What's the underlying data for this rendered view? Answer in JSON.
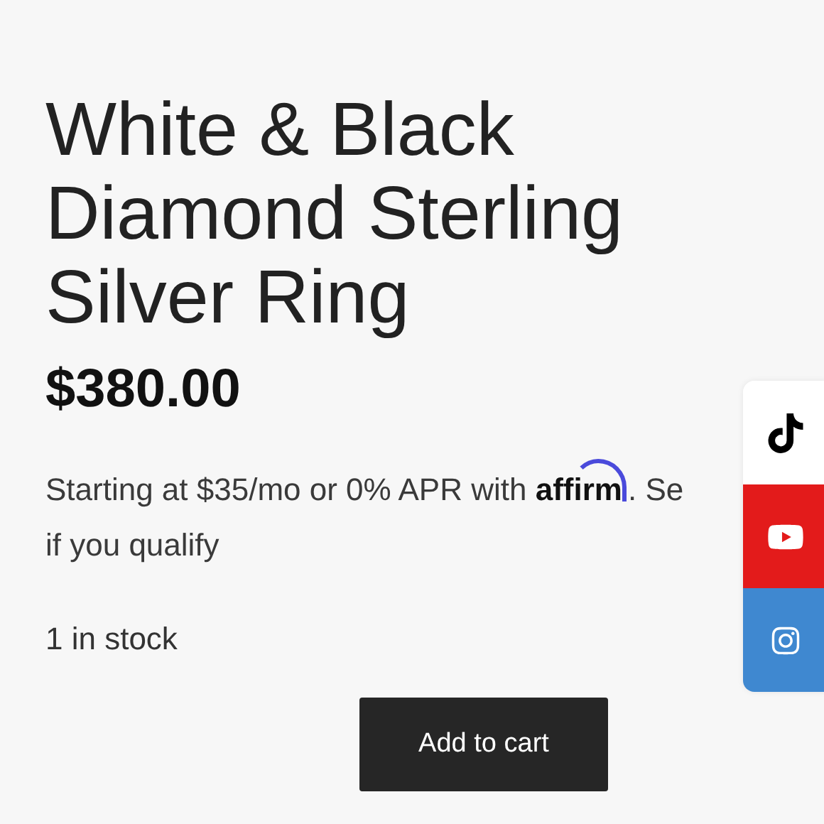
{
  "product": {
    "title": "White & Black Diamond Sterling Silver Ring",
    "price": "$380.00",
    "financing": {
      "before": "Starting at $35/mo or 0% APR with ",
      "logo": "affirm",
      "after": ". Se",
      "line2": "if you qualify"
    },
    "stock": "1 in stock",
    "button": "Add to cart"
  },
  "social": [
    {
      "kind": "tiktok"
    },
    {
      "kind": "youtube"
    },
    {
      "kind": "instagram"
    }
  ]
}
